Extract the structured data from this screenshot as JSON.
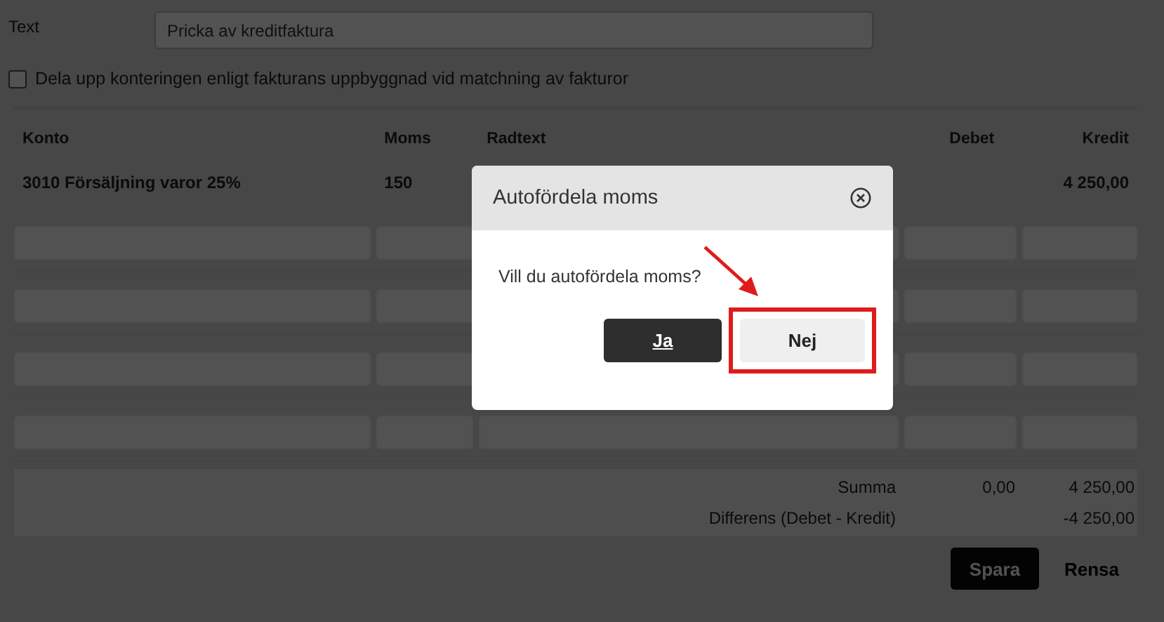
{
  "form": {
    "text_label": "Text",
    "text_value": "Pricka av kreditfaktura",
    "split_checkbox": {
      "label": "Dela upp konteringen enligt fakturans uppbyggnad vid matchning av fakturor",
      "checked": false
    }
  },
  "table": {
    "columns": [
      "Konto",
      "Moms",
      "Radtext",
      "Debet",
      "Kredit"
    ],
    "rows": [
      {
        "kind": "filled",
        "konto": "3010 Försäljning varor 25%",
        "moms": "150",
        "kredit": "4 250,00"
      },
      {
        "kind": "blank"
      },
      {
        "kind": "blank"
      },
      {
        "kind": "blank"
      },
      {
        "kind": "blank"
      }
    ]
  },
  "totals": [
    {
      "label": "Summa",
      "debet": "0,00",
      "kredit": "4 250,00"
    },
    {
      "label": "Differens (Debet - Kredit)",
      "kredit": "-4 250,00"
    }
  ],
  "buttons": [
    {
      "label": "Spara",
      "kind": "primary"
    },
    {
      "label": "Rensa",
      "kind": "secondary"
    }
  ],
  "dialog": {
    "title": "Autofördela moms",
    "message": "Vill du autofördela moms?",
    "buttons": [
      {
        "label": "Ja",
        "kind": "primary",
        "highlighted": false
      },
      {
        "label": "Nej",
        "kind": "secondary",
        "highlighted": true
      }
    ]
  }
}
